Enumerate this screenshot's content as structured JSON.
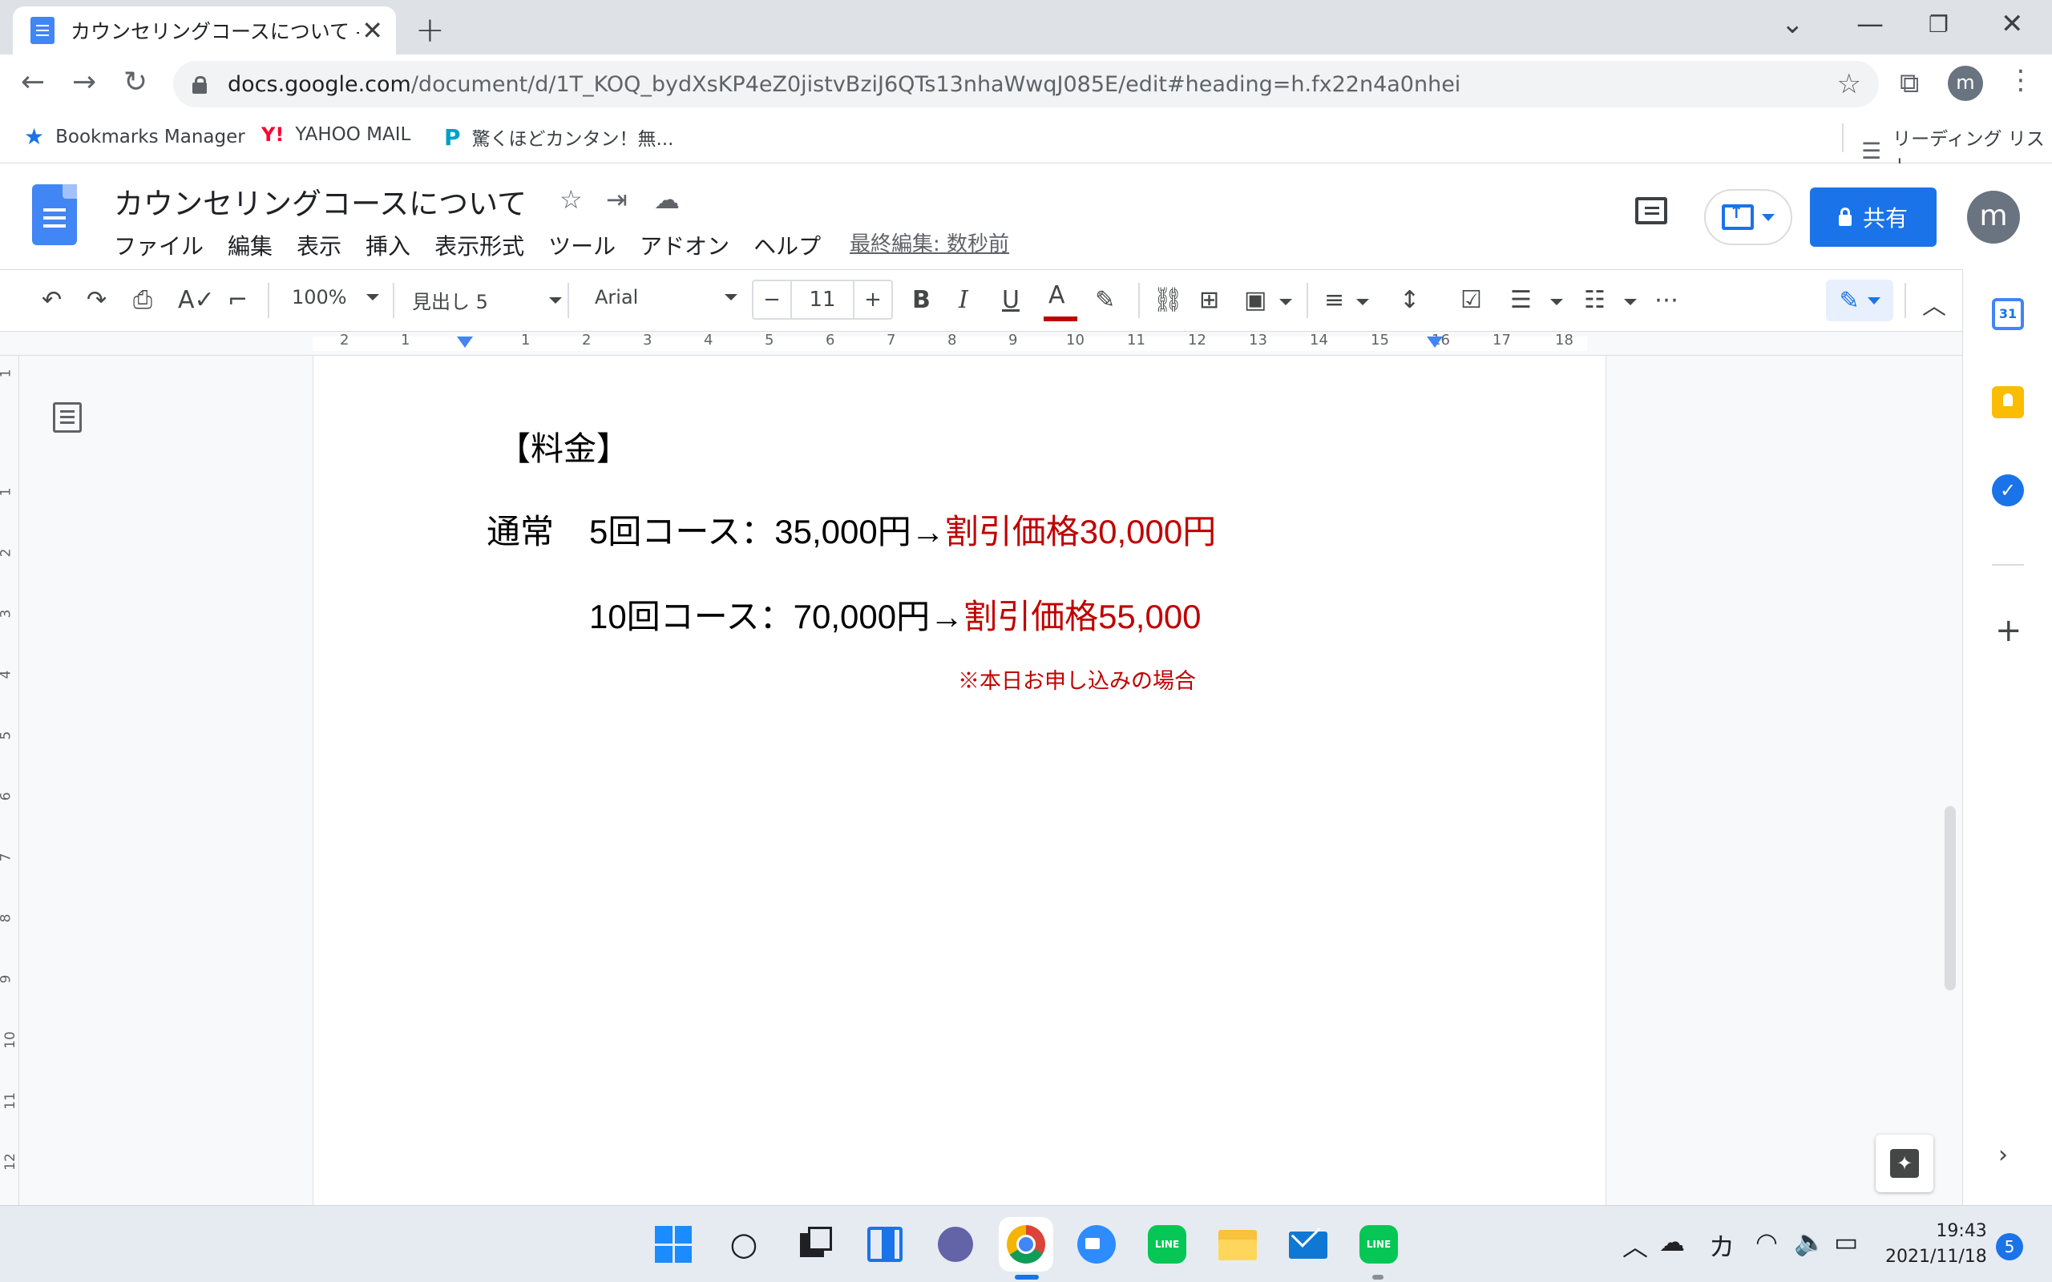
{
  "browser": {
    "tab_title": "カウンセリングコースについて - Google",
    "url_host": "docs.google.com",
    "url_path": "/document/d/1T_KOQ_bydXsKP4eZ0jistvBziJ6QTs13nhaWwqJ085E/edit#heading=h.fx22n4a0nhei",
    "profile_initial": "m",
    "bookmarks": [
      "Bookmarks Manager",
      "YAHOO MAIL",
      "驚くほどカンタン！無..."
    ],
    "reading_list": "リーディング リスト"
  },
  "docs": {
    "title": "カウンセリングコースについて",
    "menu": [
      "ファイル",
      "編集",
      "表示",
      "挿入",
      "表示形式",
      "ツール",
      "アドオン",
      "ヘルプ"
    ],
    "last_edit": "最終編集: 数秒前",
    "share_label": "共有",
    "user_initial": "m",
    "accent_color": "#1a73e8",
    "discount_color": "#c00000"
  },
  "toolbar": {
    "zoom": "100%",
    "style": "見出し 5",
    "font": "Arial",
    "font_size": "11"
  },
  "ruler": {
    "numbers": [
      "2",
      "1",
      "1",
      "2",
      "3",
      "4",
      "5",
      "6",
      "7",
      "8",
      "9",
      "10",
      "11",
      "12",
      "13",
      "14",
      "15",
      "16",
      "17",
      "18"
    ],
    "vertical_numbers": [
      "1",
      "1",
      "2",
      "3",
      "4",
      "5",
      "6",
      "7",
      "8",
      "9",
      "10",
      "11",
      "12"
    ]
  },
  "document": {
    "heading": "【料金】",
    "line1_label": "通常",
    "line1_course": "5回コース：35,000円→",
    "line1_discount": "割引価格30,000円",
    "line2_course": "10回コース：70,000円→",
    "line2_discount": "割引価格55,000",
    "note": "※本日お申し込みの場合"
  },
  "side_panel": {
    "calendar_day": "31"
  },
  "taskbar": {
    "time": "19:43",
    "date": "2021/11/18",
    "ime": "カ",
    "notifications": "5"
  }
}
